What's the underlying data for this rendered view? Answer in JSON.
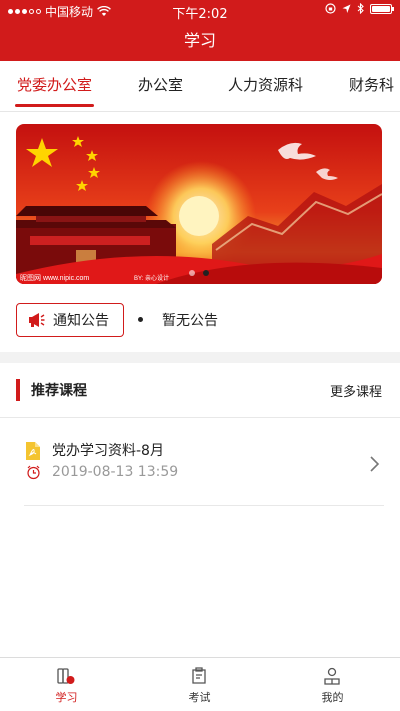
{
  "status_bar": {
    "carrier": "中国移动",
    "time": "下午2:02"
  },
  "nav": {
    "title": "学习"
  },
  "tabs": [
    {
      "label": "党委办公室",
      "active": true
    },
    {
      "label": "办公室",
      "active": false
    },
    {
      "label": "人力资源科",
      "active": false
    },
    {
      "label": "财务科",
      "active": false
    }
  ],
  "banner": {
    "pages": 2,
    "active_page": 2,
    "caption_left": "昵图网 www.nipic.com",
    "caption_right": "BY: 亲心设计"
  },
  "notice": {
    "button_label": "通知公告",
    "text": "暂无公告"
  },
  "courses_section": {
    "title": "推荐课程",
    "more_label": "更多课程",
    "items": [
      {
        "title": "党办学习资料-8月",
        "time": "2019-08-13 13:59"
      }
    ]
  },
  "bottom_tabs": [
    {
      "label": "学习",
      "icon": "book-icon",
      "active": true
    },
    {
      "label": "考试",
      "icon": "exam-icon",
      "active": false
    },
    {
      "label": "我的",
      "icon": "profile-icon",
      "active": false
    }
  ],
  "colors": {
    "accent": "#d11b1b",
    "text": "#222222",
    "muted": "#999999",
    "file_icon": "#f4c430"
  }
}
